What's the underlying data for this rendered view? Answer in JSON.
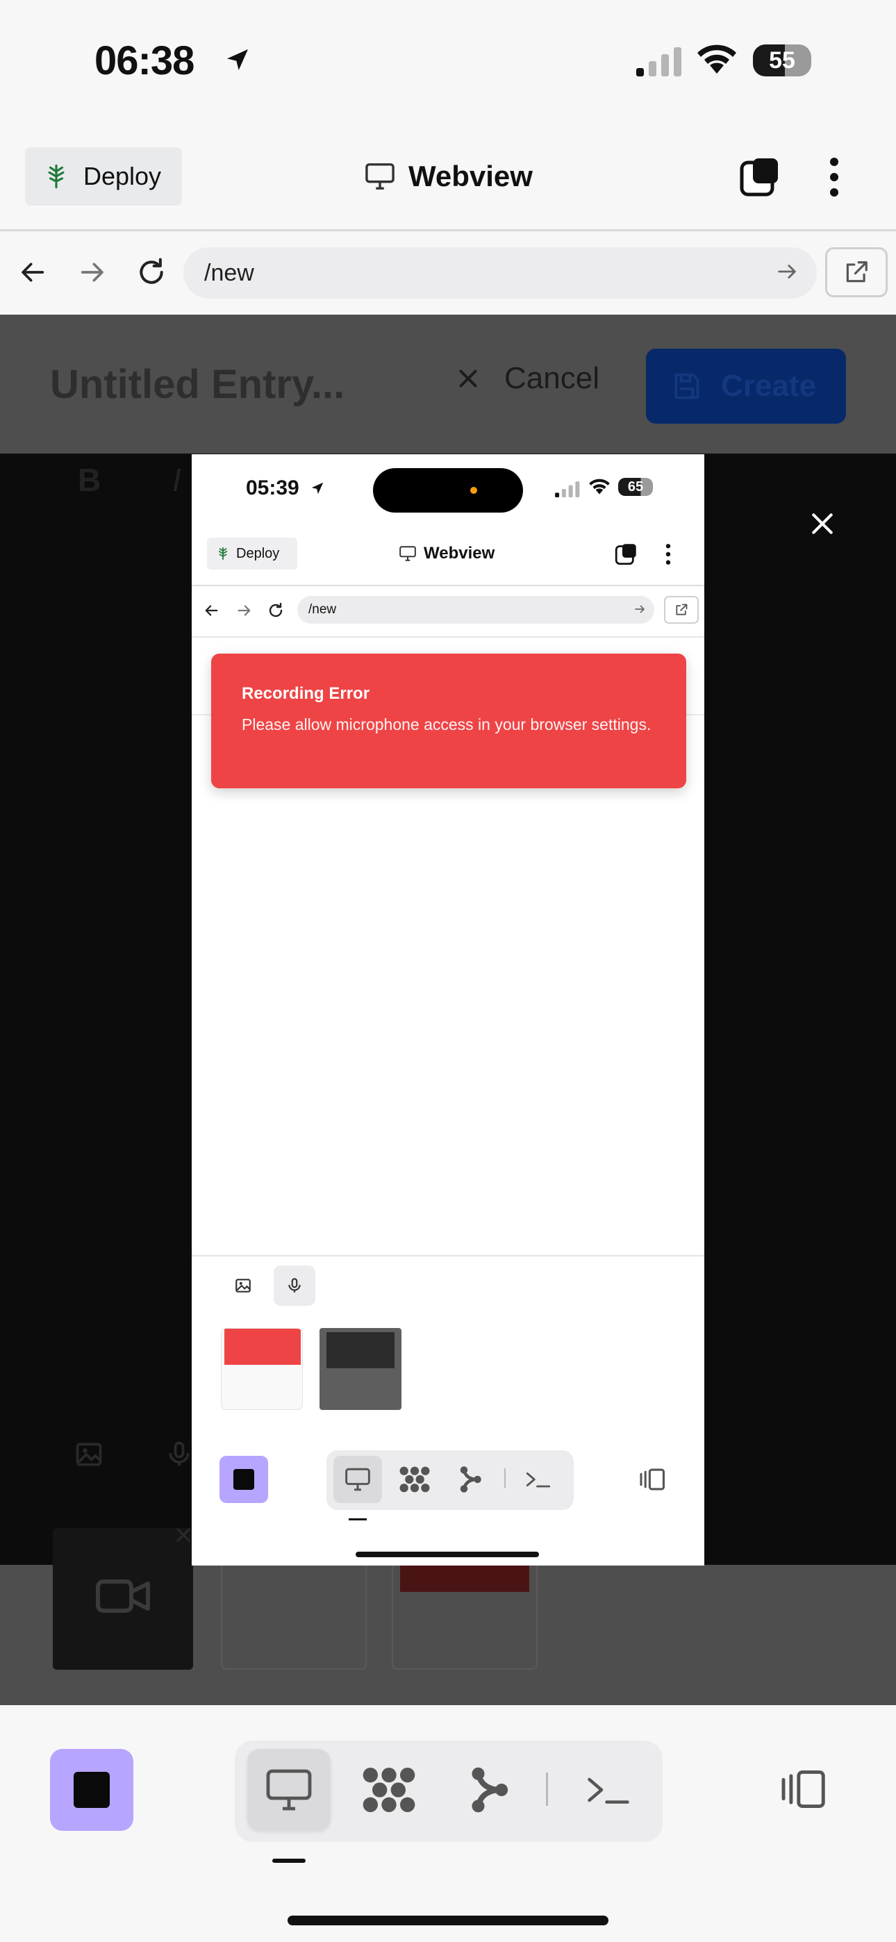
{
  "status_bar": {
    "time": "06:38",
    "battery": "55"
  },
  "header": {
    "deploy_label": "Deploy",
    "title": "Webview"
  },
  "url_bar": {
    "value": "/new"
  },
  "editor": {
    "title": "Untitled Entry...",
    "cancel_label": "Cancel",
    "create_label": "Create",
    "bold": "B",
    "italic": "I"
  },
  "inner_screenshot": {
    "status_time": "05:39",
    "battery": "65",
    "deploy_label": "Deploy",
    "title": "Webview",
    "url_value": "/new",
    "toast": {
      "title": "Recording Error",
      "message": "Please allow microphone access in your browser settings."
    }
  },
  "colors": {
    "accent_stop": "#b7a5ff",
    "toast_error": "#ef4446",
    "create_button": "#07296a"
  },
  "toolbar": {
    "active_tab": "webview",
    "tabs": [
      "monitor-icon",
      "grid-icon",
      "branch-icon",
      "terminal-icon"
    ],
    "right_icon": "panel-toggle-icon"
  }
}
